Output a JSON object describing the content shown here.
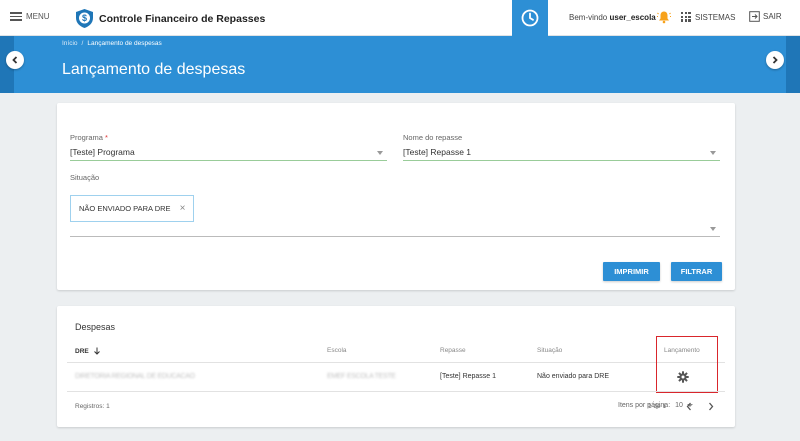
{
  "header": {
    "menu_label": "MENU",
    "app_title": "Controle Financeiro de Repasses",
    "welcome_prefix": "Bem-vindo",
    "username": "user_escola",
    "systems_label": "SISTEMAS",
    "logout_label": "SAIR"
  },
  "breadcrumb": {
    "home": "Início",
    "separator": "/",
    "current": "Lançamento de despesas"
  },
  "page_title": "Lançamento de despesas",
  "filters": {
    "programa_label": "Programa",
    "programa_required": "*",
    "programa_value": "[Teste] Programa",
    "repasse_label": "Nome do repasse",
    "repasse_value": "[Teste] Repasse 1",
    "situacao_label": "Situação",
    "situacao_chip": "NÃO ENVIADO PARA DRE",
    "chip_remove": "×",
    "print_button": "IMPRIMIR",
    "filter_button": "FILTRAR"
  },
  "expenses": {
    "title": "Despesas",
    "columns": [
      "DRE",
      "Escola",
      "Repasse",
      "Situação",
      "Lançamento"
    ],
    "rows": [
      {
        "dre": "DIRETORIA REGIONAL DE EDUCACAO",
        "escola": "EMEF ESCOLA TESTE",
        "repasse": "[Teste] Repasse 1",
        "situacao": "Não enviado para DRE"
      }
    ],
    "records_label": "Registros: 1",
    "per_page_label": "Itens por página:",
    "per_page_value": "10",
    "page_info": "1 de 1"
  },
  "colors": {
    "primary": "#2d8fd5",
    "highlight": "#d9262c"
  }
}
